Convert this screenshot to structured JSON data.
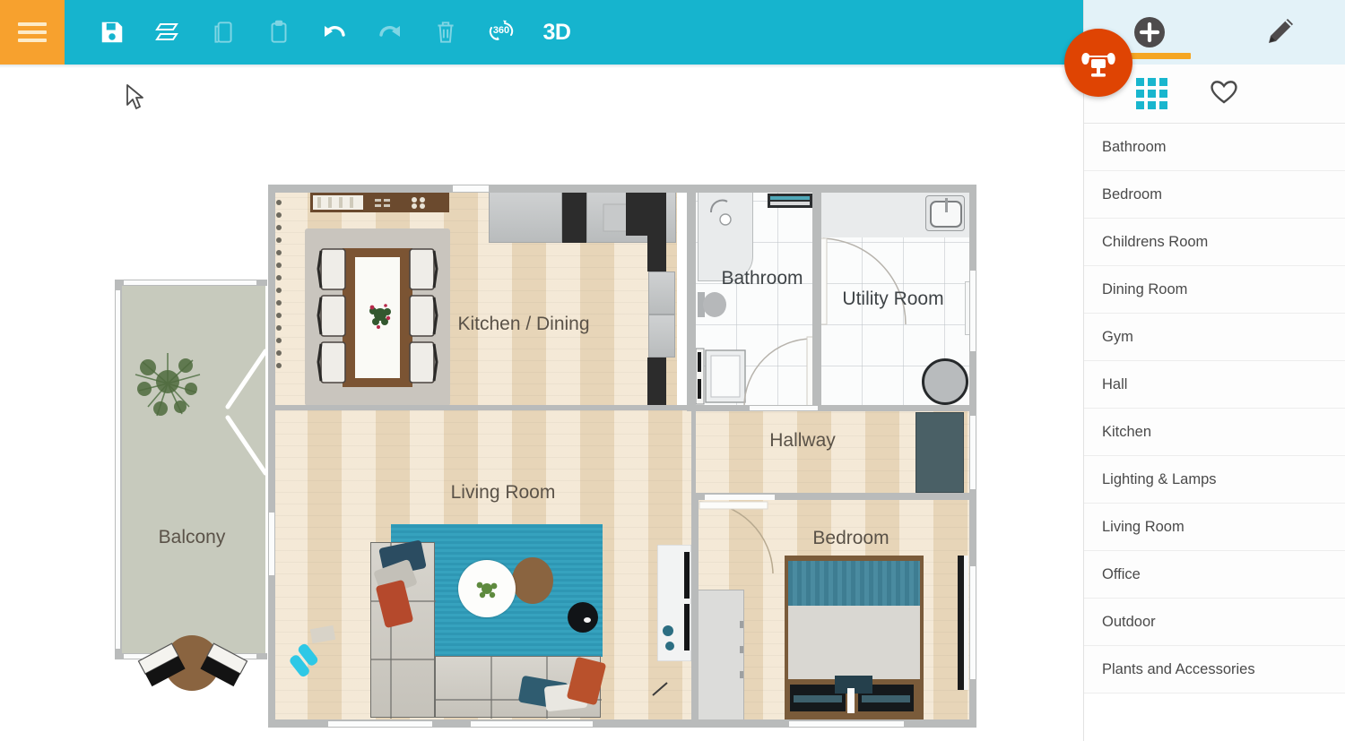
{
  "app": {
    "accent_teal": "#16B4CE",
    "accent_orange": "#F7A12E",
    "badge_orange": "#DF4403",
    "panel_header_bg": "#E3F2F8"
  },
  "toolbar": {
    "menu_label": "Menu",
    "tools": [
      {
        "name": "save-icon",
        "label": "Save",
        "enabled": true
      },
      {
        "name": "layers-icon",
        "label": "Floors / Layers",
        "enabled": true
      },
      {
        "name": "copy-icon",
        "label": "Copy",
        "enabled": false
      },
      {
        "name": "paste-icon",
        "label": "Paste",
        "enabled": false
      },
      {
        "name": "undo-icon",
        "label": "Undo",
        "enabled": true
      },
      {
        "name": "redo-icon",
        "label": "Redo",
        "enabled": false
      },
      {
        "name": "trash-icon",
        "label": "Delete",
        "enabled": false
      },
      {
        "name": "view-360-icon",
        "label": "360",
        "enabled": true
      },
      {
        "name": "view-3d-label",
        "label": "3D",
        "enabled": true
      }
    ]
  },
  "right_panel": {
    "tabs": [
      {
        "name": "add-tab",
        "icon": "plus-circle-icon",
        "label": "Add",
        "active": true
      },
      {
        "name": "edit-tab",
        "icon": "pencil-icon",
        "label": "Edit",
        "active": false
      }
    ],
    "badge": {
      "icon": "armchair-icon",
      "label": "Furniture"
    },
    "subbar": [
      {
        "name": "grid-view-toggle",
        "icon": "grid-icon",
        "label": "All categories",
        "active": true
      },
      {
        "name": "favorites-toggle",
        "icon": "heart-icon",
        "label": "Favorites",
        "active": false
      }
    ],
    "categories": [
      {
        "label": "Bathroom"
      },
      {
        "label": "Bedroom"
      },
      {
        "label": "Childrens Room"
      },
      {
        "label": "Dining Room"
      },
      {
        "label": "Gym"
      },
      {
        "label": "Hall"
      },
      {
        "label": "Kitchen"
      },
      {
        "label": "Lighting & Lamps"
      },
      {
        "label": "Living Room"
      },
      {
        "label": "Office"
      },
      {
        "label": "Outdoor"
      },
      {
        "label": "Plants and Accessories"
      }
    ]
  },
  "floor_plan": {
    "rooms": [
      {
        "name": "kitchen-dining",
        "label": "Kitchen / Dining",
        "floor": "wood"
      },
      {
        "name": "bathroom",
        "label": "Bathroom",
        "floor": "tile"
      },
      {
        "name": "utility-room",
        "label": "Utility Room",
        "floor": "tile"
      },
      {
        "name": "living-room",
        "label": "Living Room",
        "floor": "wood"
      },
      {
        "name": "hallway",
        "label": "Hallway",
        "floor": "wood"
      },
      {
        "name": "bedroom",
        "label": "Bedroom",
        "floor": "wood"
      },
      {
        "name": "balcony",
        "label": "Balcony",
        "floor": "outdoor"
      }
    ],
    "colors": {
      "wall": "#B9BBBB",
      "wood_floor": "#EEDCBE",
      "tile_floor": "#FBFCFC",
      "balcony_floor": "#C7CABD",
      "rug_living": "#2E97B4",
      "rug_dining": "#C9C5BE",
      "label_text": "#5a5248"
    }
  }
}
